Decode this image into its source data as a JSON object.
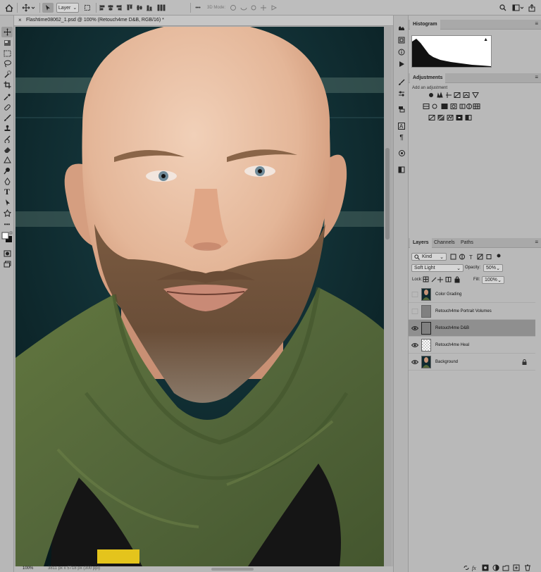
{
  "options_bar": {
    "layer_dropdown": "Layer",
    "mode_3d_label": "3D Mode:"
  },
  "document": {
    "tab_title": "Flashtime08062_1.psd @ 100% (Retouch4me D&B, RGB/16) *",
    "close_symbol": "×"
  },
  "status_bar": {
    "zoom": "100%",
    "dimensions": "3811 px x 5718 px (300 ppi)"
  },
  "histogram_panel": {
    "tab": "Histogram",
    "warning_symbol": "▲"
  },
  "adjustments_panel": {
    "tab": "Adjustments",
    "subtitle": "Add an adjustment"
  },
  "layers_panel": {
    "tabs": [
      "Layers",
      "Channels",
      "Paths"
    ],
    "filter_kind": "Kind",
    "blend_mode": "Soft Light",
    "opacity_label": "Opacity:",
    "opacity_value": "50%",
    "lock_label": "Lock:",
    "fill_label": "Fill:",
    "fill_value": "100%",
    "layers": [
      {
        "name": "Color Grading",
        "visible": false,
        "selected": false,
        "thumb": "dark"
      },
      {
        "name": "Retouch4me Portrait Volumes",
        "visible": false,
        "selected": false,
        "thumb": "gray"
      },
      {
        "name": "Retouch4me D&B",
        "visible": true,
        "selected": true,
        "thumb": "gray"
      },
      {
        "name": "Retouch4me Heal",
        "visible": true,
        "selected": false,
        "thumb": "transparent"
      },
      {
        "name": "Background",
        "visible": true,
        "selected": false,
        "thumb": "dark",
        "locked": true
      }
    ]
  },
  "colors": {
    "canvas_bg": "#0e2e33",
    "panel_bg": "#b9b9b9",
    "selected_layer": "#8f8f8f",
    "scarf": "#55693a",
    "skin": "#e2b496",
    "beard": "#6e5139"
  }
}
